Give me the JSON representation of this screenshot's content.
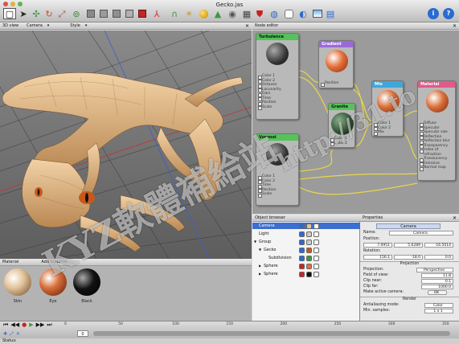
{
  "window": {
    "title": "Gecko.jas"
  },
  "toolbar": {
    "icons": [
      "select-icon",
      "cursor-icon",
      "move-icon",
      "rotate-icon",
      "scale-icon",
      "cube-icon",
      "cube-icon",
      "cube-icon",
      "cube-icon",
      "red-cube-icon",
      "joint-icon",
      "bend-icon",
      "light-icon",
      "sphere-icon",
      "cone-icon",
      "camera-icon",
      "render-icon",
      "shield-icon",
      "globe-icon",
      "material-icon",
      "scene-icon",
      "image-icon",
      "info-icon",
      "help-icon"
    ]
  },
  "viewport": {
    "view_label": "3D view",
    "camera_label": "Camera",
    "style_label": "Style"
  },
  "node_editor": {
    "title": "Node editor",
    "nodes": [
      {
        "name": "Turbulence",
        "rows": [
          "Color 1",
          "Color 2",
          "Octaves",
          "Lacunarity",
          "Gain",
          "Time",
          "Position",
          "Scale"
        ]
      },
      {
        "name": "Gradient",
        "rows": [
          "Position"
        ]
      },
      {
        "name": "Granite",
        "rows": [
          "Color 1",
          "Color 2"
        ]
      },
      {
        "name": "Mix",
        "rows": [
          "Color 1",
          "Color 2",
          "Mix"
        ]
      },
      {
        "name": "Material",
        "rows": [
          "Diffuse",
          "Specular",
          "Specular size",
          "Reflection",
          "Reflection blur",
          "Transparency",
          "Index of refraction",
          "Translucency",
          "Emissive",
          "Normal map"
        ]
      },
      {
        "name": "Voronoi",
        "rows": [
          "Color 1",
          "Color 2",
          "Time",
          "Position",
          "Scale"
        ]
      }
    ]
  },
  "object_browser": {
    "title": "Object browser",
    "items": [
      {
        "label": "Camera",
        "indent": 1,
        "selected": true
      },
      {
        "label": "Light",
        "indent": 1,
        "selected": false
      },
      {
        "label": "Group",
        "indent": 1,
        "selected": false,
        "arrow": "▼"
      },
      {
        "label": "Gecko",
        "indent": 2,
        "selected": false,
        "arrow": "▼"
      },
      {
        "label": "Subdivision",
        "indent": 3,
        "selected": false
      },
      {
        "label": "Sphere",
        "indent": 2,
        "selected": false,
        "arrow": "▶"
      },
      {
        "label": "Sphere",
        "indent": 2,
        "selected": false,
        "arrow": "▶"
      }
    ]
  },
  "properties": {
    "title": "Properties",
    "tab": "Camera",
    "name_label": "Name:",
    "name_value": "Camera",
    "position_label": "Position:",
    "position": [
      "7.0951",
      "5.6289",
      "-16.5014"
    ],
    "rotation_label": "Rotation:",
    "rotation": [
      "156.1",
      "-18.0",
      "0.0"
    ],
    "projection_section": "Projection",
    "projection_label": "Projection:",
    "projection_value": "Perspective",
    "fov_label": "Field of view:",
    "fov_value": "11.8",
    "clip_near_label": "Clip near:",
    "clip_near_value": "0.1",
    "clip_far_label": "Clip far:",
    "clip_far_value": "1000.0",
    "make_active_label": "Make active camera:",
    "make_active_btn": "OK",
    "render_section": "Render",
    "antialias_label": "Antialiasing mode:",
    "antialias_value": "Color",
    "min_samples_label": "Min. samples:",
    "min_samples_value": "1 x 1"
  },
  "materials": {
    "header": "Material",
    "add_label": "Add material",
    "items": [
      {
        "label": "Skin"
      },
      {
        "label": "Eye"
      },
      {
        "label": "Black"
      }
    ]
  },
  "timeline": {
    "frame": "0",
    "ticks": [
      "0",
      "50",
      "100",
      "150",
      "200",
      "250",
      "300",
      "350"
    ]
  },
  "status": {
    "text": "Status:"
  },
  "watermark": {
    "text1": "KYZ軟體補給站",
    "text2": "http://31.to"
  },
  "colors": {
    "accent": "#3d6fd1"
  }
}
